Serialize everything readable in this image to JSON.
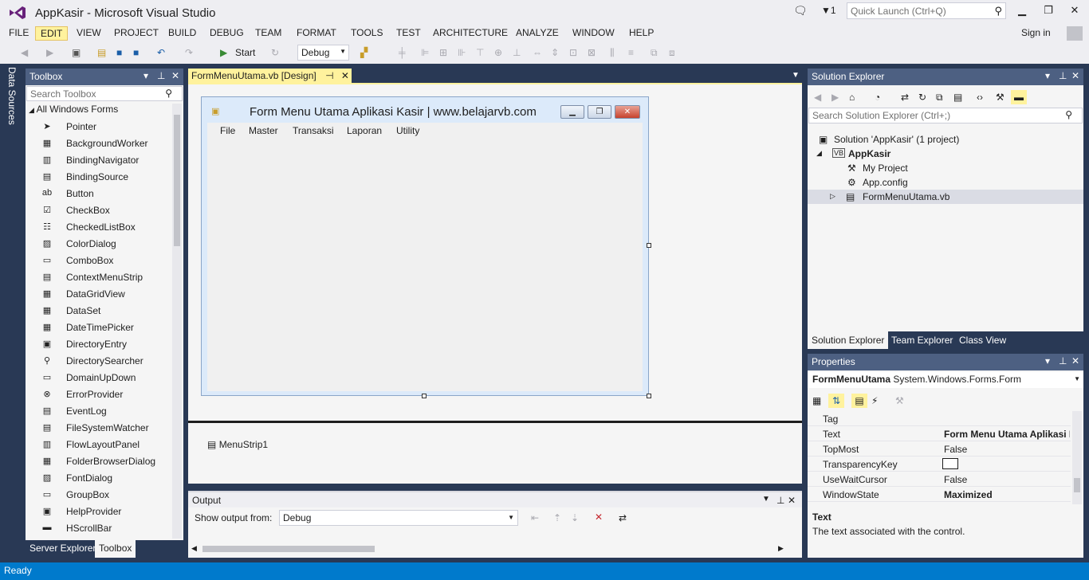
{
  "window": {
    "title": "AppKasir - Microsoft Visual Studio",
    "notification_count": "1",
    "quick_launch_placeholder": "Quick Launch (Ctrl+Q)",
    "sign_in": "Sign in"
  },
  "menu": [
    "FILE",
    "EDIT",
    "VIEW",
    "PROJECT",
    "BUILD",
    "DEBUG",
    "TEAM",
    "FORMAT",
    "TOOLS",
    "TEST",
    "ARCHITECTURE",
    "ANALYZE",
    "WINDOW",
    "HELP"
  ],
  "toolbar": {
    "start_label": "Start",
    "config": "Debug"
  },
  "left_strip": {
    "label": "Data Sources"
  },
  "toolbox": {
    "title": "Toolbox",
    "search_placeholder": "Search Toolbox",
    "group": "All Windows Forms",
    "items": [
      "Pointer",
      "BackgroundWorker",
      "BindingNavigator",
      "BindingSource",
      "Button",
      "CheckBox",
      "CheckedListBox",
      "ColorDialog",
      "ComboBox",
      "ContextMenuStrip",
      "DataGridView",
      "DataSet",
      "DateTimePicker",
      "DirectoryEntry",
      "DirectorySearcher",
      "DomainUpDown",
      "ErrorProvider",
      "EventLog",
      "FileSystemWatcher",
      "FlowLayoutPanel",
      "FolderBrowserDialog",
      "FontDialog",
      "GroupBox",
      "HelpProvider",
      "HScrollBar"
    ],
    "tabs": [
      "Server Explorer",
      "Toolbox"
    ]
  },
  "document": {
    "tab_label": "FormMenuUtama.vb [Design]",
    "form": {
      "title": "Form Menu Utama Aplikasi Kasir | www.belajarvb.com",
      "menu": [
        "File",
        "Master",
        "Transaksi",
        "Laporan",
        "Utility"
      ]
    },
    "tray_component": "MenuStrip1"
  },
  "output": {
    "title": "Output",
    "show_from_label": "Show output from:",
    "source": "Debug"
  },
  "solution_explorer": {
    "title": "Solution Explorer",
    "search_placeholder": "Search Solution Explorer (Ctrl+;)",
    "tree": {
      "solution": "Solution 'AppKasir' (1 project)",
      "project": "AppKasir",
      "items": [
        "My Project",
        "App.config",
        "FormMenuUtama.vb"
      ]
    },
    "tabs": [
      "Solution Explorer",
      "Team Explorer",
      "Class View"
    ]
  },
  "properties": {
    "title": "Properties",
    "object_name": "FormMenuUtama",
    "object_type": "System.Windows.Forms.Form",
    "rows": [
      {
        "name": "Tag",
        "value": ""
      },
      {
        "name": "Text",
        "value": "Form Menu Utama Aplikasi Kasir | www.belajarvb.com"
      },
      {
        "name": "TopMost",
        "value": "False"
      },
      {
        "name": "TransparencyKey",
        "value": ""
      },
      {
        "name": "UseWaitCursor",
        "value": "False"
      },
      {
        "name": "WindowState",
        "value": "Maximized"
      }
    ],
    "desc_title": "Text",
    "desc_text": "The text associated with the control."
  },
  "status": {
    "text": "Ready"
  },
  "colors": {
    "accent_blue": "#007acc",
    "panel_header": "#4d6082",
    "highlight_yellow": "#fff29d",
    "frame_navy": "#293955"
  }
}
